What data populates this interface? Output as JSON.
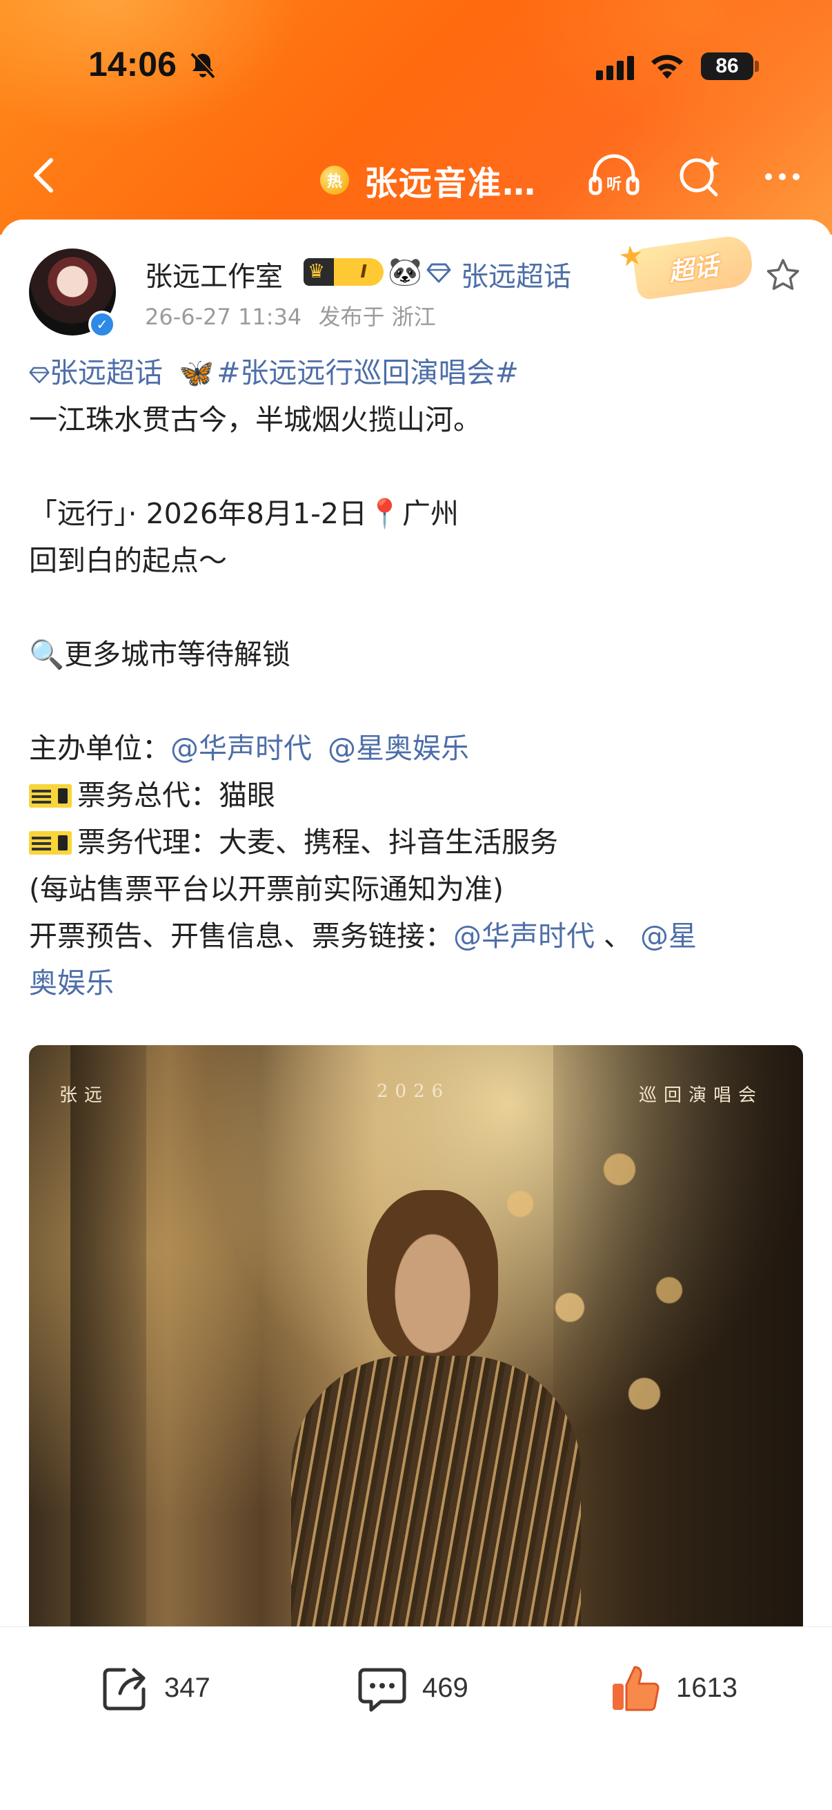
{
  "status_bar": {
    "time": "14:06",
    "battery": "86"
  },
  "nav": {
    "hot_badge": "热",
    "title": "张远音准…"
  },
  "post": {
    "author": "张远工作室",
    "vip_level": "I",
    "chaohua_tag": "张远超话",
    "timestamp": "26-6-27 11:34",
    "location": "发布于 浙江",
    "super_sticker": "超话",
    "body": {
      "tag_chaohua": "张远超话",
      "butterfly": "🦋",
      "tag_topic": "#张远远行巡回演唱会#",
      "line_poem": "一江珠水贯古今，半城烟火揽山河。",
      "line_date_prefix": "「远行」· 2026年8月1-2日",
      "pin": "📍",
      "line_date_city": "广州",
      "line_return": "回到白的起点～",
      "magnifier": "🔍",
      "line_more": "更多城市等待解锁",
      "organizer_label": "主办单位：",
      "organizer_1": "@华声时代",
      "organizer_2": "@星奥娱乐",
      "ticket_general_label": "票务总代：",
      "ticket_general": "猫眼",
      "ticket_agent_label": "票务代理：",
      "ticket_agent": "大麦、携程、抖音生活服务",
      "note": "(每站售票平台以开票前实际通知为准)",
      "notice_label": "开票预告、开售信息、票务链接：",
      "notice_link_1": "@华声时代",
      "notice_sep": " 、",
      "notice_link_2a": "@星",
      "notice_link_2b": "奥娱乐"
    },
    "poster": {
      "left": "张远",
      "center": "2026",
      "right": "巡回演唱会"
    }
  },
  "actions": {
    "share_count": "347",
    "comment_count": "469",
    "like_count": "1613"
  },
  "colors": {
    "accent": "#ff7a1a",
    "link": "#4d6ea8",
    "like": "#f26b3a"
  }
}
